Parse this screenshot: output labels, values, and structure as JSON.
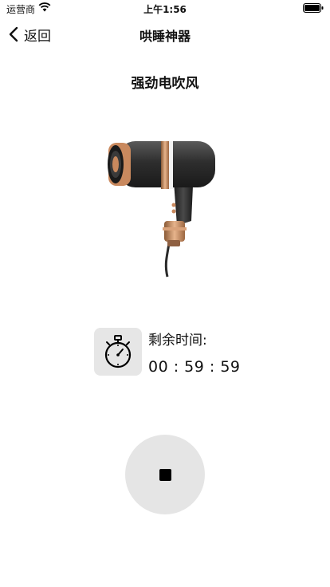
{
  "status_bar": {
    "carrier": "运营商",
    "time": "上午1:56"
  },
  "nav": {
    "back_label": "返回",
    "title": "哄睡神器"
  },
  "device": {
    "name": "强劲电吹风",
    "image_icon": "hairdryer-image"
  },
  "timer": {
    "label": "剩余时间:",
    "value": "00 : 59 : 59",
    "icon": "stopwatch-icon"
  },
  "controls": {
    "stop_icon": "stop-icon"
  },
  "colors": {
    "button_bg": "#e5e5e5",
    "icon_bg": "#e6e6e6",
    "accent_copper": "#c98b5b"
  }
}
